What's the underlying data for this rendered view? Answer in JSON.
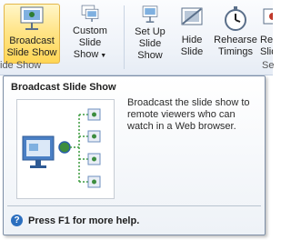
{
  "ribbon": {
    "buttons": [
      {
        "label_line1": "Broadcast",
        "label_line2": "Slide Show"
      },
      {
        "label_line1": "Custom",
        "label_line2": "Slide Show"
      },
      {
        "label_line1": "Set Up",
        "label_line2": "Slide Show"
      },
      {
        "label_line1": "Hide",
        "label_line2": "Slide"
      },
      {
        "label_line1": "Rehearse",
        "label_line2": "Timings"
      },
      {
        "label_line1": "Rec",
        "label_line2": "Slide"
      }
    ],
    "group_left_label": "ide Show",
    "group_right_label": "Se"
  },
  "tooltip": {
    "title": "Broadcast Slide Show",
    "description": "Broadcast the slide show to remote viewers who can watch in a Web browser.",
    "help_text": "Press F1 for more help."
  }
}
